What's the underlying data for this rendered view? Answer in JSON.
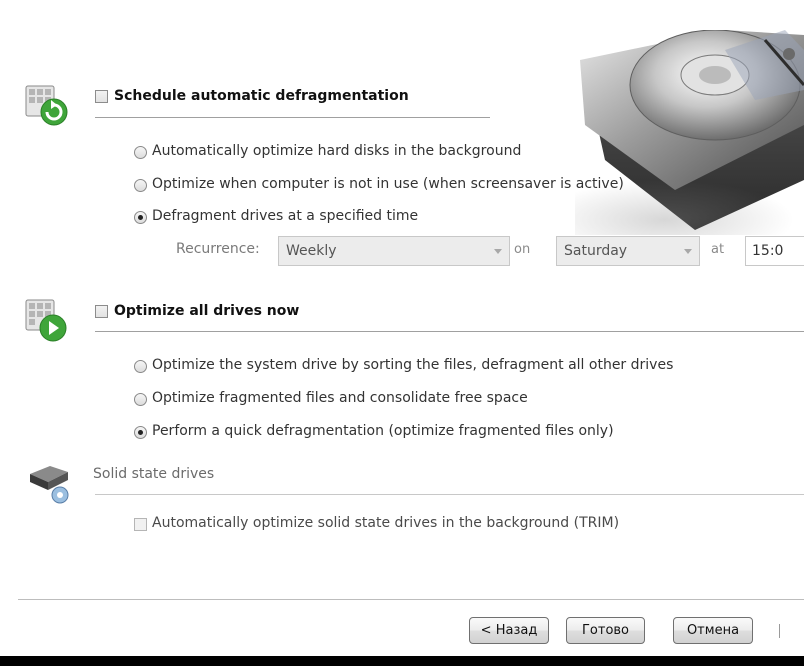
{
  "schedule": {
    "title": "Schedule automatic defragmentation",
    "options": [
      {
        "label": "Automatically optimize hard disks in the background",
        "selected": false
      },
      {
        "label": "Optimize when computer is not in use (when screensaver is active)",
        "selected": false
      },
      {
        "label": "Defragment drives at a specified time",
        "selected": true
      }
    ],
    "recurrence_label": "Recurrence:",
    "recurrence_value": "Weekly",
    "on_label": "on",
    "day_value": "Saturday",
    "at_label": "at",
    "time_value": "15:0"
  },
  "optimize": {
    "title": "Optimize all drives now",
    "options": [
      {
        "label": "Optimize the system drive by sorting the files, defragment all other drives",
        "selected": false
      },
      {
        "label": "Optimize fragmented files and consolidate free space",
        "selected": false
      },
      {
        "label": "Perform a quick defragmentation (optimize fragmented files only)",
        "selected": true
      }
    ]
  },
  "ssd": {
    "title": "Solid state drives",
    "trim_label": "Automatically optimize solid state drives in the background (TRIM)"
  },
  "footer": {
    "back": "< Назад",
    "done": "Готово",
    "cancel": "Отмена"
  },
  "colors": {
    "accent_green": "#3fa53a",
    "separator": "#a0a0a0"
  },
  "icons": {
    "schedule": "calendar-refresh-icon",
    "optimize": "play-drives-icon",
    "ssd": "ssd-drive-icon",
    "header_graphic": "hard-disk-icon"
  }
}
